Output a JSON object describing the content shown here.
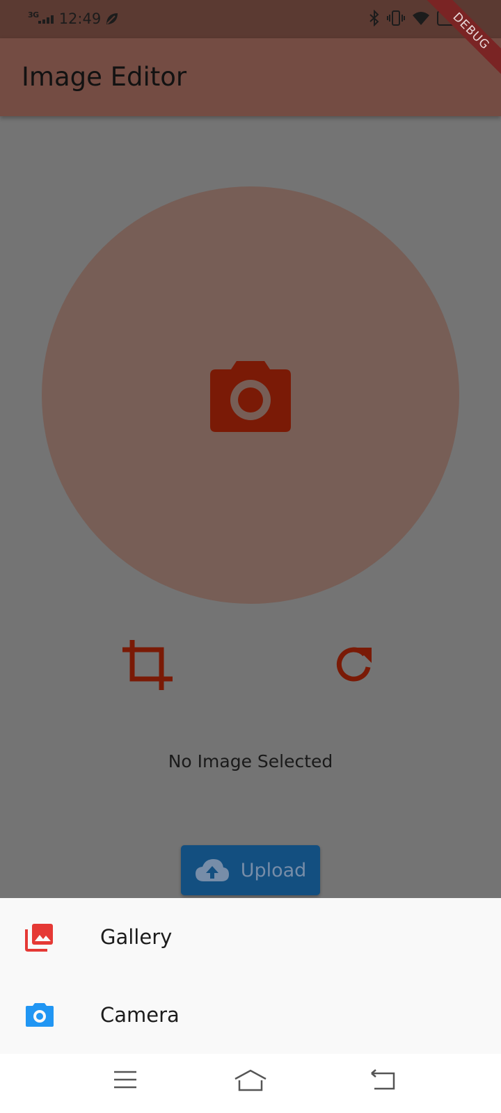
{
  "status_bar": {
    "network_type": "3G",
    "time": "12:49"
  },
  "debug_banner": "DEBUG",
  "app_bar": {
    "title": "Image Editor"
  },
  "main": {
    "status_text": "No Image Selected",
    "upload_label": "Upload"
  },
  "bottom_sheet": {
    "items": [
      {
        "label": "Gallery",
        "icon": "photo-library-icon",
        "color": "#e53935"
      },
      {
        "label": "Camera",
        "icon": "camera-icon",
        "color": "#2196f3"
      }
    ]
  },
  "colors": {
    "accent": "#7a1a06",
    "app_bar": "#744c43",
    "upload_button": "#134f80"
  }
}
